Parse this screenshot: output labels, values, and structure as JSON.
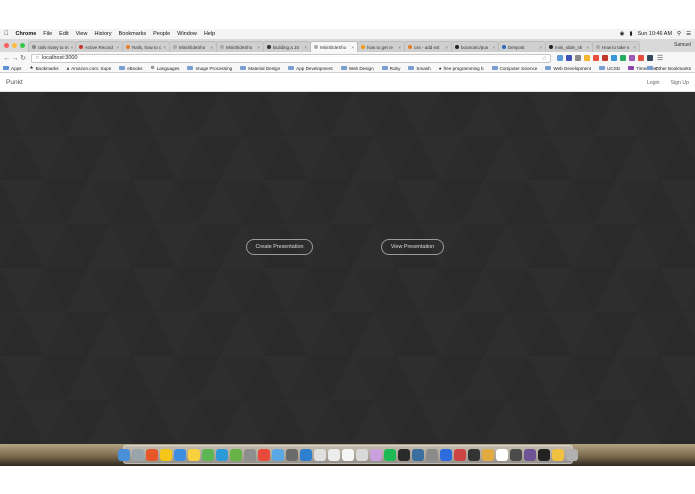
{
  "menubar": {
    "apple": "",
    "items": [
      "Chrome",
      "File",
      "Edit",
      "View",
      "History",
      "Bookmarks",
      "People",
      "Window",
      "Help"
    ],
    "clock": "Sun 10:46 AM",
    "user_icon": "user-icon"
  },
  "tabs": [
    {
      "title": "rails many to m",
      "active": false
    },
    {
      "title": "Active Record",
      "active": false
    },
    {
      "title": "Rails, how to c",
      "active": false
    },
    {
      "title": "MiniSlideSho",
      "active": false
    },
    {
      "title": "MiniSlideSho",
      "active": false
    },
    {
      "title": "Building a JS",
      "active": false
    },
    {
      "title": "MiniSlideSho",
      "active": true
    },
    {
      "title": "how to get re",
      "active": false
    },
    {
      "title": "css - add ext",
      "active": false
    },
    {
      "title": "bootronic/pun",
      "active": false
    },
    {
      "title": "Devpost",
      "active": false
    },
    {
      "title": "mini_slide_sh",
      "active": false
    },
    {
      "title": "How to take s",
      "active": false
    }
  ],
  "profile_name": "Samuel",
  "address": {
    "url": "localhost:3000"
  },
  "bookmarks": {
    "items": [
      "Apps",
      "Bookmarks",
      "Amazon.com: Supe",
      "eBooks",
      "Languages",
      "Image Processing",
      "Material Design",
      "App Development",
      "Web Design",
      "Ruby",
      "Smash",
      "free programming b",
      "Computer Science",
      "Web Development",
      "UCSD",
      "Timesheet"
    ],
    "other": "Other Bookmarks"
  },
  "app": {
    "brand": "Punkt",
    "login": "Login",
    "signup": "Sign Up",
    "create_button": "Create Presentation",
    "view_button": "View Presentation"
  },
  "colors": {
    "background": "#2f2f2f",
    "button_border": "#9a9a9a",
    "button_text": "#dedede"
  }
}
